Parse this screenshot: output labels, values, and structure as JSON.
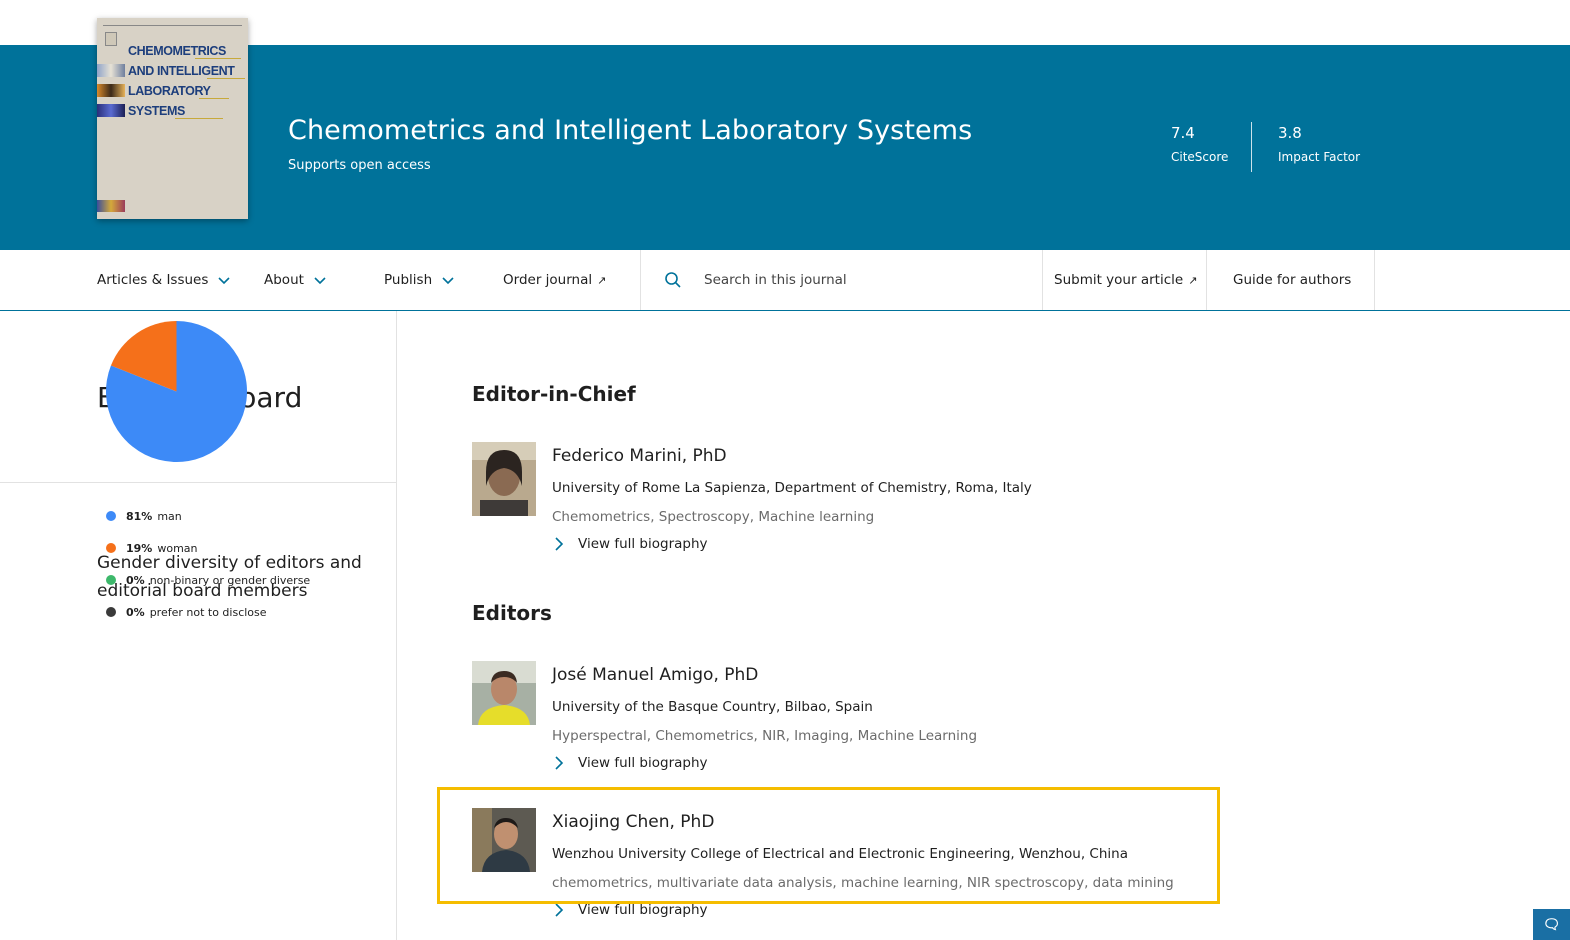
{
  "journal": {
    "title": "Chemometrics and Intelligent Laboratory Systems",
    "open_access": "Supports open access",
    "cover": {
      "lines": [
        "CHEMOMETRICS",
        "AND INTELLIGENT",
        "LABORATORY",
        "SYSTEMS"
      ]
    },
    "metrics": [
      {
        "value": "7.4",
        "label": "CiteScore"
      },
      {
        "value": "3.8",
        "label": "Impact Factor"
      }
    ]
  },
  "nav": {
    "articles": "Articles & Issues",
    "about": "About",
    "publish": "Publish",
    "order": "Order journal",
    "search_placeholder": "Search in this journal",
    "submit": "Submit your article",
    "guide": "Guide for authors"
  },
  "page": {
    "title": "Editorial board",
    "gender_title": "Gender diversity of editors and editorial board members"
  },
  "gender": {
    "items": [
      {
        "pct": "81%",
        "label": "man",
        "color": "#3d8af7"
      },
      {
        "pct": "19%",
        "label": "woman",
        "color": "#f5701a"
      },
      {
        "pct": "0%",
        "label": "non-binary or gender diverse",
        "color": "#3db86b"
      },
      {
        "pct": "0%",
        "label": "prefer not to disclose",
        "color": "#3a3a3a"
      }
    ],
    "values": [
      81,
      19,
      0,
      0
    ]
  },
  "sections": {
    "editor_in_chief": "Editor-in-Chief",
    "editors": "Editors"
  },
  "people": [
    {
      "name": "Federico Marini, PhD",
      "affiliation": "University of Rome La Sapienza, Department of Chemistry, Roma, Italy",
      "keywords": "Chemometrics, Spectroscopy, Machine learning",
      "bio_link": "View full biography"
    },
    {
      "name": "José Manuel Amigo, PhD",
      "affiliation": "University of the Basque Country, Bilbao, Spain",
      "keywords": "Hyperspectral, Chemometrics, NIR, Imaging, Machine Learning",
      "bio_link": "View full biography"
    },
    {
      "name": "Xiaojing Chen, PhD",
      "affiliation": "Wenzhou University College of Electrical and Electronic Engineering, Wenzhou, China",
      "keywords": "chemometrics, multivariate data analysis, machine learning, NIR spectroscopy, data mining",
      "bio_link": "View full biography"
    }
  ]
}
